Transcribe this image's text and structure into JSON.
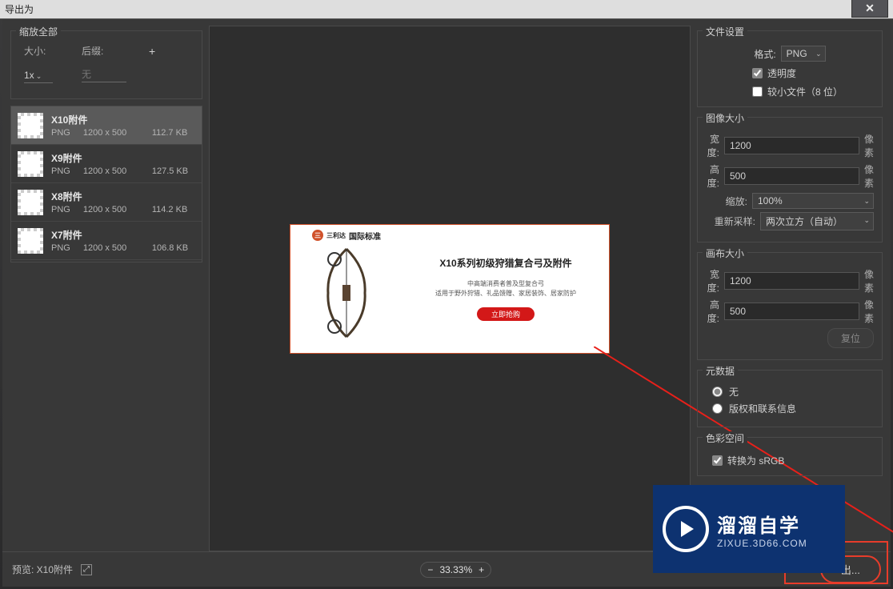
{
  "title": "导出为",
  "left": {
    "scale_section": "缩放全部",
    "size_label": "大小:",
    "suffix_label": "后缀:",
    "scale_value": "1x",
    "suffix_placeholder": "无",
    "assets": [
      {
        "name": "X10附件",
        "fmt": "PNG",
        "dim": "1200 x 500",
        "size": "112.7 KB"
      },
      {
        "name": "X9附件",
        "fmt": "PNG",
        "dim": "1200 x 500",
        "size": "127.5 KB"
      },
      {
        "name": "X8附件",
        "fmt": "PNG",
        "dim": "1200 x 500",
        "size": "114.2 KB"
      },
      {
        "name": "X7附件",
        "fmt": "PNG",
        "dim": "1200 x 500",
        "size": "106.8 KB"
      }
    ]
  },
  "preview": {
    "logo_text": "国际标准",
    "logo_sub": "三利达",
    "title": "X10系列初级狩猎复合弓及附件",
    "sub1": "中高端消费者普及型复合弓",
    "sub2": "适用于野外狩猎、礼品馈赠、家居装饰、居家防护",
    "button": "立即抢购"
  },
  "right": {
    "file_settings": "文件设置",
    "format_label": "格式:",
    "format_value": "PNG",
    "transparency": "透明度",
    "small_file": "较小文件（8 位）",
    "image_size": "图像大小",
    "width_label": "宽度:",
    "width_value": "1200",
    "height_label": "高度:",
    "height_value": "500",
    "scale_label": "缩放:",
    "scale_value": "100%",
    "resample_label": "重新采样:",
    "resample_value": "两次立方（自动）",
    "px": "像素",
    "canvas_size": "画布大小",
    "c_width": "1200",
    "c_height": "500",
    "reset": "复位",
    "metadata": "元数据",
    "meta_none": "无",
    "meta_copyright": "版权和联系信息",
    "colorspace": "色彩空间",
    "srgb": "转换为 sRGB"
  },
  "bottom": {
    "preview_label": "预览: X10附件",
    "zoom": "33.33%",
    "export": "出..."
  },
  "watermark": {
    "line1": "溜溜自学",
    "line2": "ZIXUE.3D66.COM"
  }
}
